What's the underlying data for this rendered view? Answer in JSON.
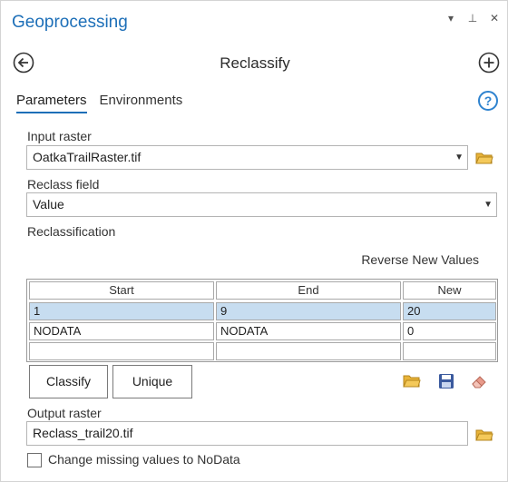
{
  "pane": {
    "title": "Geoprocessing",
    "controls": [
      "▾",
      "⊥",
      "✕"
    ]
  },
  "tool": {
    "title": "Reclassify"
  },
  "tabs": [
    {
      "label": "Parameters",
      "active": true
    },
    {
      "label": "Environments",
      "active": false
    }
  ],
  "help_glyph": "?",
  "input_raster": {
    "label": "Input raster",
    "value": "OatkaTrailRaster.tif"
  },
  "reclass_field": {
    "label": "Reclass field",
    "value": "Value"
  },
  "reclassification": {
    "label": "Reclassification",
    "reverse_label": "Reverse New Values",
    "columns": [
      "Start",
      "End",
      "New"
    ],
    "rows": [
      [
        "1",
        "9",
        "20"
      ],
      [
        "NODATA",
        "NODATA",
        "0"
      ],
      [
        "",
        "",
        ""
      ]
    ],
    "classify_label": "Classify",
    "unique_label": "Unique"
  },
  "output_raster": {
    "label": "Output raster",
    "value": "Reclass_trail20.tif"
  },
  "missing_values": {
    "label": "Change missing values to NoData",
    "checked": false
  },
  "colors": {
    "accent": "#1d6fb8",
    "selected_row": "#c7ddf0",
    "folder": "#e8b339",
    "save": "#3b5a9e",
    "eraser": "#e89a8a"
  }
}
